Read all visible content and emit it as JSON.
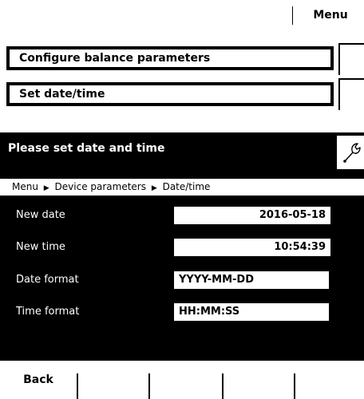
{
  "header": {
    "menu_label": "Menu"
  },
  "menu_rows": [
    {
      "label": "Configure balance parameters"
    },
    {
      "label": "Set date/time"
    }
  ],
  "dialog": {
    "title": "Please set date and time",
    "tool_icon": "wrench-icon",
    "breadcrumb": [
      "Menu",
      "Device parameters",
      "Date/time"
    ],
    "breadcrumb_separator": "▶",
    "fields": {
      "new_date": {
        "label": "New date",
        "value": "2016-05-18"
      },
      "new_time": {
        "label": "New time",
        "value": "10:54:39"
      },
      "date_format": {
        "label": "Date format",
        "value": "YYYY-MM-DD"
      },
      "time_format": {
        "label": "Time format",
        "value": "HH:MM:SS"
      }
    }
  },
  "softkeys": {
    "back_label": "Back"
  }
}
